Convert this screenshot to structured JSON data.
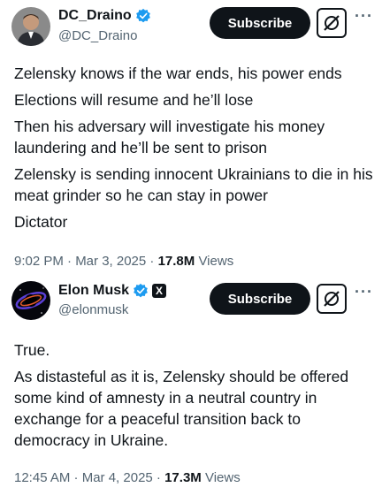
{
  "posts": [
    {
      "display_name": "DC_Draino",
      "handle": "@DC_Draino",
      "verified": true,
      "subscribe_label": "Subscribe",
      "paragraphs": [
        "Zelensky knows if the war ends, his power ends",
        "Elections will resume and he’ll lose",
        "Then his adversary will investigate his money laundering and he’ll be sent to prison",
        "Zelensky is sending innocent Ukrainians to die in his meat grinder so he can stay in power",
        "Dictator"
      ],
      "timestamp": "9:02 PM · Mar 3, 2025 · ",
      "views": "17.8M",
      "views_label": " Views"
    },
    {
      "display_name": "Elon Musk",
      "handle": "@elonmusk",
      "verified": true,
      "affiliate_badge": "X",
      "subscribe_label": "Subscribe",
      "paragraphs": [
        "True.",
        "As distasteful as it is, Zelensky should be offered some kind of amnesty in a neutral country in exchange for a peaceful transition back to democracy in Ukraine."
      ],
      "timestamp": "12:45 AM · Mar 4, 2025 · ",
      "views": "17.3M",
      "views_label": " Views"
    }
  ],
  "icons": {
    "verified": "verified-badge-icon",
    "grok": "grok-icon",
    "more": "more-icon"
  },
  "colors": {
    "verified_blue": "#1d9bf0",
    "secondary_text": "#536471",
    "primary_text": "#0f1419"
  }
}
